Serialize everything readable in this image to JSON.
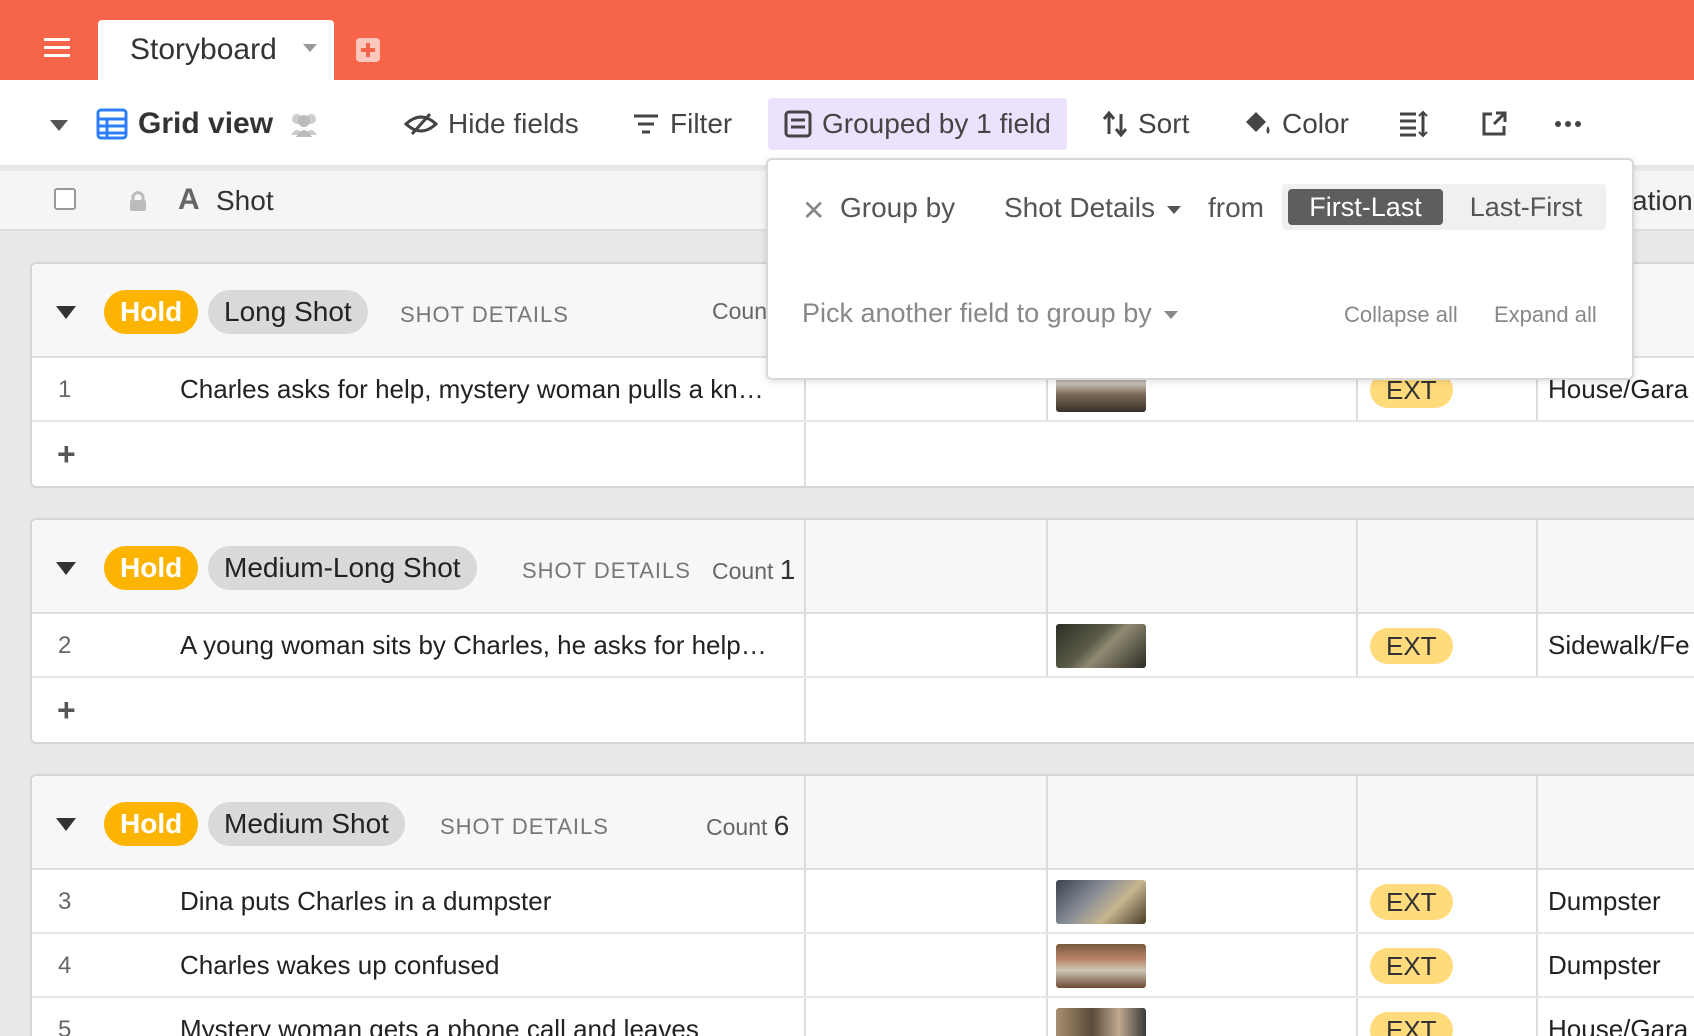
{
  "tabs": {
    "active_label": "Storyboard"
  },
  "toolbar": {
    "view_name": "Grid view",
    "hide_fields": "Hide fields",
    "filter": "Filter",
    "grouped": "Grouped by 1 field",
    "sort": "Sort",
    "color": "Color"
  },
  "columns": {
    "shot": "Shot",
    "location_partial": "ation"
  },
  "popover": {
    "group_by": "Group by",
    "field": "Shot Details",
    "from": "from",
    "order_selected": "First-Last",
    "order_other": "Last-First",
    "pick_another": "Pick another field to group by",
    "collapse_all": "Collapse all",
    "expand_all": "Expand all"
  },
  "groups": [
    {
      "status": "Hold",
      "shot_type": "Long Shot",
      "field_label": "SHOT DETAILS",
      "count_label": "Count",
      "rows": [
        {
          "num": "1",
          "shot": "Charles asks for help, mystery woman pulls a kn…",
          "ext": "EXT",
          "location": "House/Gara"
        }
      ]
    },
    {
      "status": "Hold",
      "shot_type": "Medium-Long Shot",
      "field_label": "SHOT DETAILS",
      "count_label": "Count",
      "count": "1",
      "rows": [
        {
          "num": "2",
          "shot": "A young woman sits by Charles, he asks for help…",
          "ext": "EXT",
          "location": "Sidewalk/Fe"
        }
      ]
    },
    {
      "status": "Hold",
      "shot_type": "Medium Shot",
      "field_label": "SHOT DETAILS",
      "count_label": "Count",
      "count": "6",
      "rows": [
        {
          "num": "3",
          "shot": "Dina puts Charles in a dumpster",
          "ext": "EXT",
          "location": "Dumpster"
        },
        {
          "num": "4",
          "shot": "Charles wakes up confused",
          "ext": "EXT",
          "location": "Dumpster"
        },
        {
          "num": "5",
          "shot": "Mystery woman gets a phone call and leaves",
          "ext": "EXT",
          "location": "House/Gara"
        }
      ]
    }
  ],
  "add_row_symbol": "+",
  "colors": {
    "topbar": "#f6654a",
    "hold": "#fcb400",
    "ext": "#ffdb7c",
    "grouped_bg": "#ede2fd",
    "grid_icon": "#2d7ff9"
  }
}
